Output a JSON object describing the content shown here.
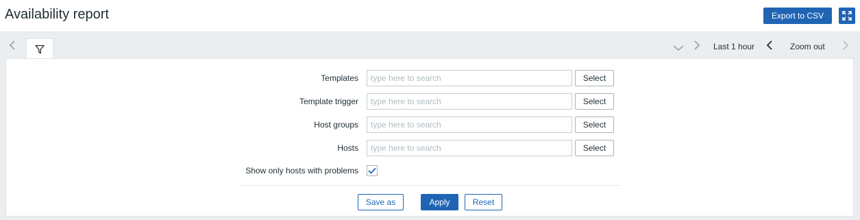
{
  "page": {
    "title": "Availability report"
  },
  "header": {
    "export_label": "Export to CSV"
  },
  "timebar": {
    "range_label": "Last 1 hour",
    "zoom_label": "Zoom out"
  },
  "filter": {
    "fields": [
      {
        "label": "Templates",
        "placeholder": "type here to search",
        "button": "Select"
      },
      {
        "label": "Template trigger",
        "placeholder": "type here to search",
        "button": "Select"
      },
      {
        "label": "Host groups",
        "placeholder": "type here to search",
        "button": "Select"
      },
      {
        "label": "Hosts",
        "placeholder": "type here to search",
        "button": "Select"
      }
    ],
    "problems_label": "Show only hosts with problems",
    "problems_checked": true,
    "save_label": "Save as",
    "apply_label": "Apply",
    "reset_label": "Reset"
  },
  "colors": {
    "primary": "#1f65b4",
    "background": "#ebeef0"
  },
  "icons": [
    "chevron-left-icon",
    "filter-icon",
    "chevron-down-icon",
    "chevron-right-icon",
    "fullscreen-icon",
    "checkmark-icon"
  ]
}
